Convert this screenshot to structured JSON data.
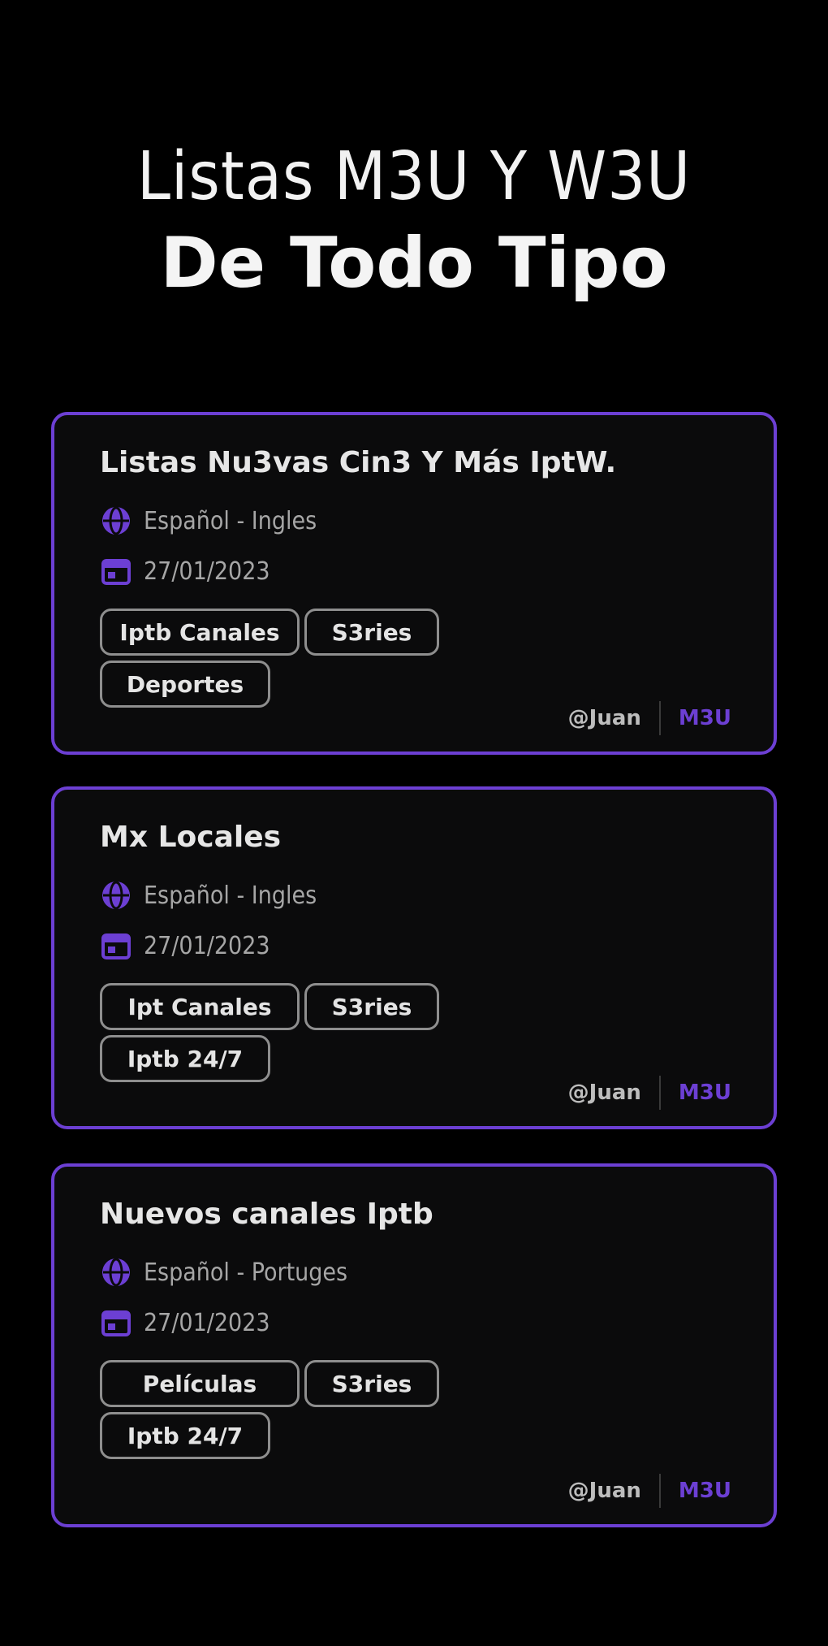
{
  "hero": {
    "line1": "Listas M3U Y W3U",
    "line2": "De Todo Tipo"
  },
  "accent_color": "#6c3fd3",
  "cards": [
    {
      "title": "Listas Nu3vas Cin3 Y Más IptW.",
      "language": "Español - Ingles",
      "date": "27/01/2023",
      "tags": [
        "Iptb Canales",
        "S3ries",
        "Deportes"
      ],
      "author": "@Juan",
      "format": "M3U"
    },
    {
      "title": "Mx Locales",
      "language": "Español - Ingles",
      "date": "27/01/2023",
      "tags": [
        "Ipt Canales",
        "S3ries",
        "Iptb 24/7"
      ],
      "author": "@Juan",
      "format": "M3U"
    },
    {
      "title": "Nuevos canales Iptb",
      "language": "Español - Portuges",
      "date": "27/01/2023",
      "tags": [
        "Películas",
        "S3ries",
        "Iptb 24/7"
      ],
      "author": "@Juan",
      "format": "M3U"
    }
  ],
  "icons": {
    "language": "globe-icon",
    "date": "calendar-icon"
  }
}
